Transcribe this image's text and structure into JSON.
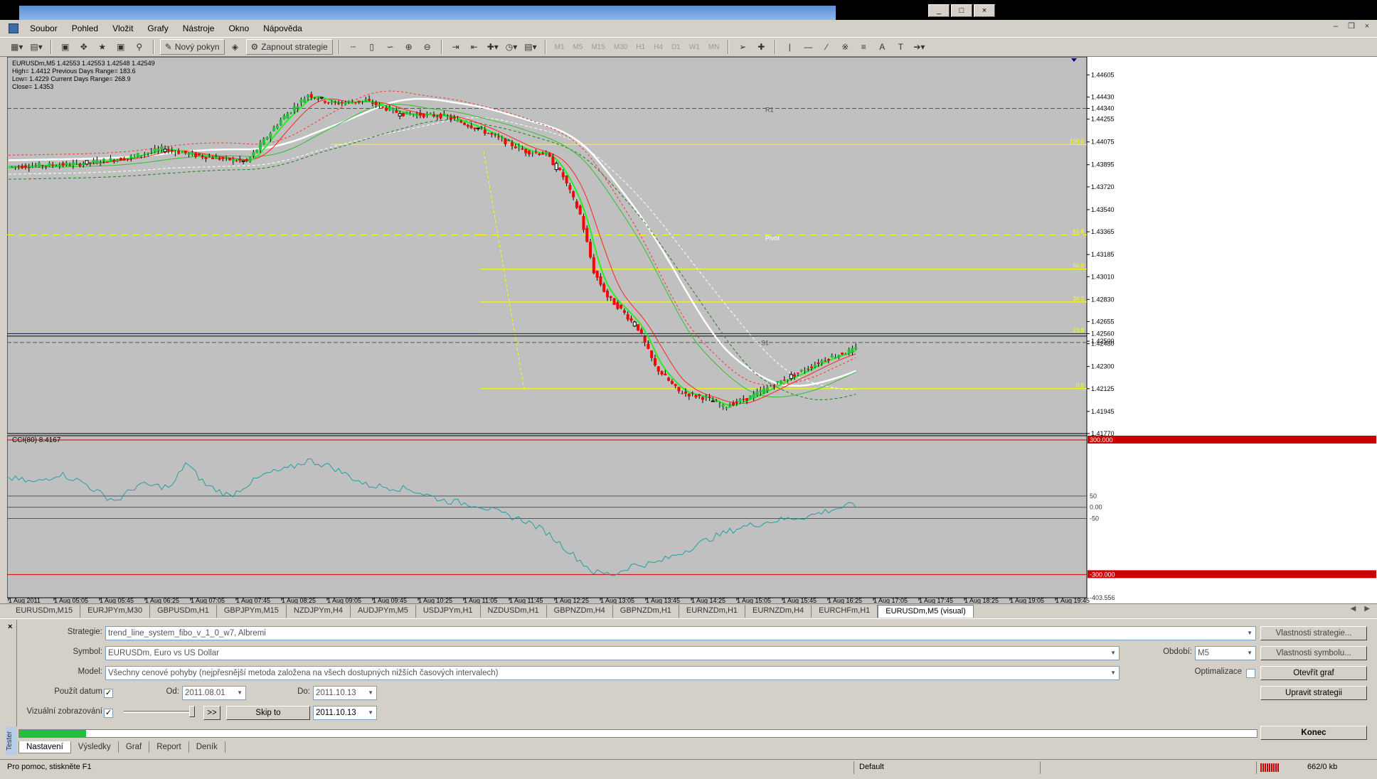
{
  "window": {
    "minimize": "_",
    "restore": "□",
    "close": "×"
  },
  "menu": [
    "Soubor",
    "Pohled",
    "Vložit",
    "Grafy",
    "Nástroje",
    "Okno",
    "Nápověda"
  ],
  "toolbar": {
    "new_order": "Nový pokyn",
    "strategies": "Zapnout strategie",
    "timeframes": [
      "M1",
      "M5",
      "M15",
      "M30",
      "H1",
      "H4",
      "D1",
      "W1",
      "MN"
    ]
  },
  "chart": {
    "info_line1": "EURUSDm,M5  1.42553 1.42553 1.42548 1.42549",
    "info_line2": "High= 1.4412   Previous Days Range= 183.6",
    "info_line3": "Low= 1.4229   Current Days Range= 268.9",
    "info_line4": "Close= 1.4353",
    "cci_label": "CCI(80) 8.4167",
    "price_ticks": [
      "1.44605",
      "1.44430",
      "1.44340",
      "1.44255",
      "1.44075",
      "1.43895",
      "1.43720",
      "1.43540",
      "1.43365",
      "1.43185",
      "1.43010",
      "1.42830",
      "1.42655",
      "1.42560",
      "1.42500",
      "1.42480",
      "1.42300",
      "1.42125",
      "1.41945",
      "1.41770"
    ],
    "cci_ticks": [
      "300.000",
      "50",
      "0.00",
      "-50",
      "-300.000",
      "-403.556"
    ],
    "time_ticks": [
      "1 Aug 2011",
      "1 Aug 05:05",
      "1 Aug 05:45",
      "1 Aug 06:25",
      "1 Aug 07:05",
      "1 Aug 07:45",
      "1 Aug 08:25",
      "1 Aug 09:05",
      "1 Aug 09:45",
      "1 Aug 10:25",
      "1 Aug 11:05",
      "1 Aug 11:45",
      "1 Aug 12:25",
      "1 Aug 13:05",
      "1 Aug 13:45",
      "1 Aug 14:25",
      "1 Aug 15:05",
      "1 Aug 15:45",
      "1 Aug 16:25",
      "1 Aug 17:05",
      "1 Aug 17:45",
      "1 Aug 18:25",
      "1 Aug 19:05",
      "1 Aug 19:45"
    ],
    "fib_labels": [
      "100.0",
      "61.8",
      "50.0",
      "38.2",
      "23.6",
      "0.0"
    ],
    "level_labels": {
      "r1": "R1",
      "pivot": "Pivot",
      "s1": "S1"
    },
    "colors": {
      "bull": "#22c03c",
      "bear": "#ff0000",
      "background": "#c0c0c0",
      "fib": "#ffff00",
      "cci": "#20a0a0"
    }
  },
  "chart_tabs": [
    "EURUSDm,M15",
    "EURJPYm,M30",
    "GBPUSDm,H1",
    "GBPJPYm,M15",
    "NZDJPYm,H4",
    "AUDJPYm,M5",
    "USDJPYm,H1",
    "NZDUSDm,H1",
    "GBPNZDm,H4",
    "GBPNZDm,H1",
    "EURNZDm,H1",
    "EURNZDm,H4",
    "EURCHFm,H1",
    "EURUSDm,M5 (visual)"
  ],
  "active_chart_tab": 13,
  "tester": {
    "title": "Tester",
    "strategy_label": "Strategie:",
    "strategy_value": "trend_line_system_fibo_v_1_0_w7, Albremi",
    "symbol_label": "Symbol:",
    "symbol_value": "EURUSDm, Euro vs US Dollar",
    "model_label": "Model:",
    "model_value": "Všechny cenové pohyby (nejpřesnější metoda založena na všech dostupných nižších časových intervalech)",
    "use_date_label": "Použít datum",
    "from_label": "Od:",
    "from_value": "2011.08.01",
    "to_label": "Do:",
    "to_value": "2011.10.13",
    "visual_label": "Vizuální zobrazování",
    "skip_btn": ">>",
    "skip_to_btn": "Skip to",
    "skip_to_value": "2011.10.13",
    "period_label": "Období:",
    "period_value": "M5",
    "optimization_label": "Optimalizace",
    "btn_expert_props": "Vlastnosti strategie...",
    "btn_symbol_props": "Vlastnosti symbolu...",
    "btn_open_chart": "Otevřít graf",
    "btn_modify_expert": "Upravit strategii",
    "btn_stop": "Konec",
    "progress": 0.054,
    "tabs": [
      "Nastavení",
      "Výsledky",
      "Graf",
      "Report",
      "Deník"
    ],
    "active_tab": 0
  },
  "status": {
    "help": "Pro pomoc, stiskněte F1",
    "profile": "Default",
    "traffic": "662/0 kb"
  }
}
